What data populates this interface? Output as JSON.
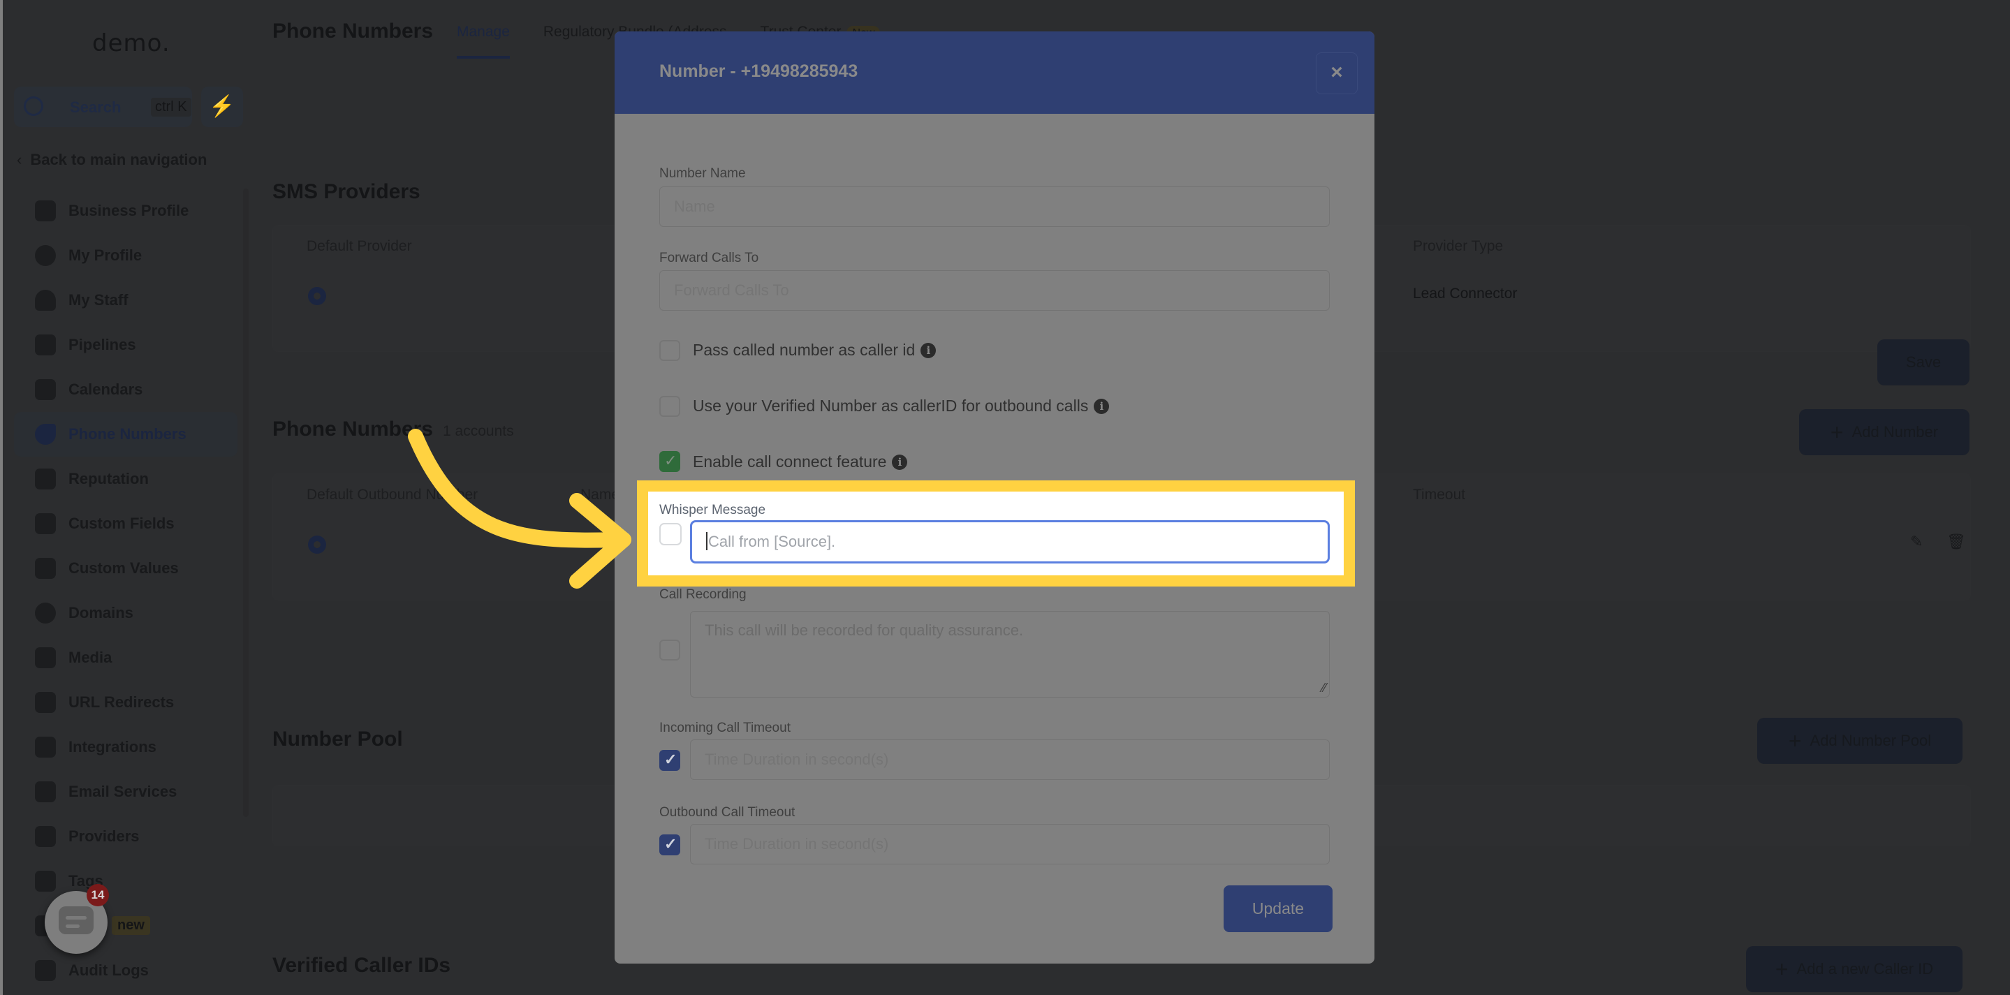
{
  "sidebar": {
    "logo": "demo.",
    "search_label": "Search",
    "search_shortcut": "ctrl K",
    "quick_action_icon": "lightning-bolt-icon",
    "back_label": "Back to main navigation",
    "items": [
      {
        "label": "Business Profile",
        "icon": "briefcase-icon"
      },
      {
        "label": "My Profile",
        "icon": "user-circle-icon"
      },
      {
        "label": "My Staff",
        "icon": "person-icon"
      },
      {
        "label": "Pipelines",
        "icon": "funnel-icon"
      },
      {
        "label": "Calendars",
        "icon": "calendar-icon"
      },
      {
        "label": "Phone Numbers",
        "icon": "phone-icon",
        "active": true
      },
      {
        "label": "Reputation",
        "icon": "star-icon"
      },
      {
        "label": "Custom Fields",
        "icon": "text-field-icon"
      },
      {
        "label": "Custom Values",
        "icon": "gem-icon"
      },
      {
        "label": "Domains",
        "icon": "globe-icon"
      },
      {
        "label": "Media",
        "icon": "media-icon"
      },
      {
        "label": "URL Redirects",
        "icon": "cursor-icon"
      },
      {
        "label": "Integrations",
        "icon": "branch-icon"
      },
      {
        "label": "Email Services",
        "icon": "mail-icon"
      },
      {
        "label": "Providers",
        "icon": "clipboard-check-icon"
      },
      {
        "label": "Tags",
        "icon": "tag-icon"
      },
      {
        "label": "",
        "icon": "flask-icon",
        "badge": "new"
      },
      {
        "label": "Audit Logs",
        "icon": "bar-chart-icon"
      }
    ]
  },
  "main": {
    "page_title": "Phone Numbers",
    "tabs": [
      {
        "label": "Manage",
        "active": true
      },
      {
        "label": "Regulatory Bundle (Address"
      },
      {
        "label": "Trust Center",
        "badge": "New"
      }
    ],
    "sms_providers": {
      "title": "SMS Providers",
      "columns": [
        "Default Provider",
        "Provider Type"
      ],
      "row": {
        "provider_type": "Lead Connector"
      },
      "save_label": "Save"
    },
    "phone_numbers": {
      "title": "Phone Numbers",
      "count": "1 accounts",
      "add_label": "Add Number",
      "columns": [
        "Default Outbound Number",
        "Name",
        "Timeout"
      ]
    },
    "number_pool": {
      "title": "Number Pool",
      "add_label": "Add Number Pool"
    },
    "verified_caller_ids": {
      "title": "Verified Caller IDs",
      "add_label": "Add a new Caller ID"
    }
  },
  "chat_widget": {
    "unread_count": "14"
  },
  "modal": {
    "title": "Number - +19498285943",
    "close_label": "×",
    "number_name": {
      "label": "Number Name",
      "placeholder": "Name",
      "value": ""
    },
    "forward_calls": {
      "label": "Forward Calls To",
      "placeholder": "Forward Calls To",
      "value": ""
    },
    "pass_called_number": {
      "label": "Pass called number as caller id",
      "checked": false
    },
    "use_verified_number": {
      "label": "Use your Verified Number as callerID for outbound calls",
      "checked": false
    },
    "enable_call_connect": {
      "label": "Enable call connect feature",
      "checked": true
    },
    "whisper_message": {
      "label": "Whisper Message",
      "placeholder": "Call from [Source].",
      "checked": false,
      "value": ""
    },
    "call_recording": {
      "label": "Call Recording",
      "placeholder": "This call will be recorded for quality assurance.",
      "checked": false
    },
    "incoming_timeout": {
      "label": "Incoming Call Timeout",
      "placeholder": "Time Duration in second(s)",
      "checked": true
    },
    "outbound_timeout": {
      "label": "Outbound Call Timeout",
      "placeholder": "Time Duration in second(s)",
      "checked": true
    },
    "update_label": "Update"
  },
  "annotation": {
    "highlight_color": "#ffd241",
    "target": "Whisper Message"
  }
}
